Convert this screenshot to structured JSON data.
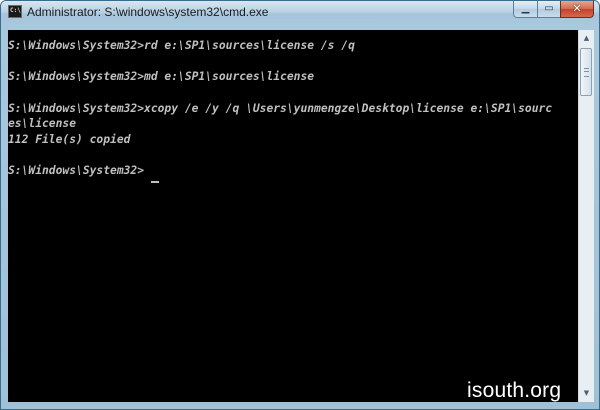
{
  "window": {
    "title": "Administrator: S:\\windows\\system32\\cmd.exe",
    "icon": "cmd-console-icon",
    "icon_text": "C:\\"
  },
  "controls": {
    "minimize_glyph": "▁",
    "maximize_glyph": "▭",
    "close_glyph": "✕"
  },
  "console": {
    "lines": [
      "S:\\Windows\\System32>rd e:\\SP1\\sources\\license /s /q",
      "",
      "S:\\Windows\\System32>md e:\\SP1\\sources\\license",
      "",
      "S:\\Windows\\System32>xcopy /e /y /q \\Users\\yunmengze\\Desktop\\license e:\\SP1\\sourc",
      "es\\license",
      "112 File(s) copied",
      "",
      "S:\\Windows\\System32>"
    ],
    "text_color": "#c0c0c0",
    "background_color": "#000000"
  },
  "scrollbar": {
    "up_glyph": "▲",
    "down_glyph": "▼"
  },
  "watermark": "isouth.org"
}
